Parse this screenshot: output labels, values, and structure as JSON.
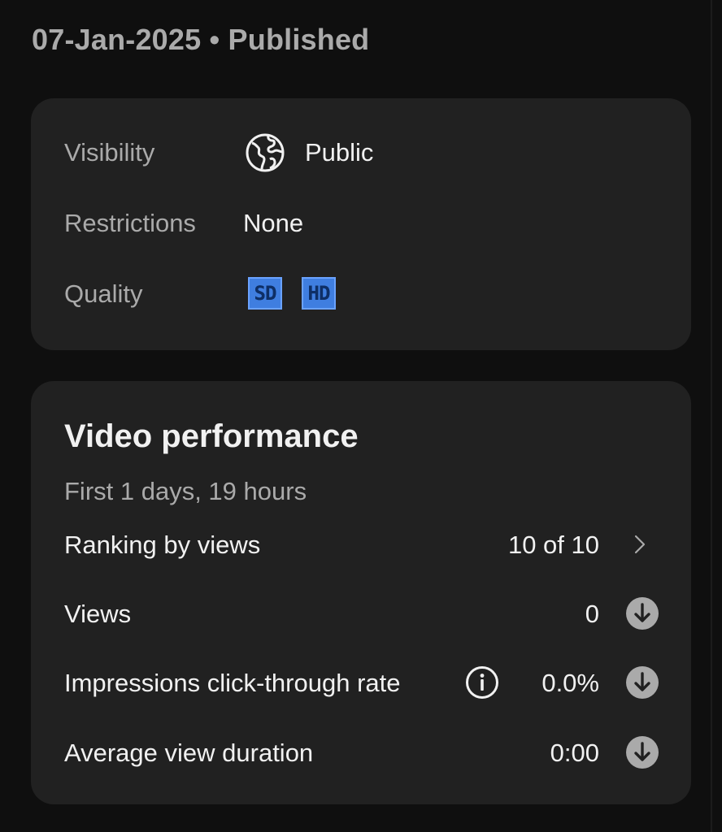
{
  "header": {
    "date_status": "07-Jan-2025 • Published"
  },
  "details": {
    "visibility": {
      "label": "Visibility",
      "value": "Public",
      "icon": "globe-icon"
    },
    "restrictions": {
      "label": "Restrictions",
      "value": "None"
    },
    "quality": {
      "label": "Quality",
      "badges": [
        "SD",
        "HD"
      ],
      "badge_color": "#3f7ee0"
    }
  },
  "performance": {
    "title": "Video performance",
    "subtitle": "First 1 days, 19 hours",
    "rows": [
      {
        "label": "Ranking by views",
        "value": "10 of 10",
        "icon": "chevron-right-icon"
      },
      {
        "label": "Views",
        "value": "0",
        "icon": "arrow-down-circle-icon"
      },
      {
        "label": "Impressions click-through rate",
        "value": "0.0%",
        "icon": "arrow-down-circle-icon",
        "info_icon": "info-icon"
      },
      {
        "label": "Average view duration",
        "value": "0:00",
        "icon": "arrow-down-circle-icon"
      }
    ]
  },
  "colors": {
    "background": "#0f0f0f",
    "card": "#212121",
    "text_primary": "#f1f1f1",
    "text_secondary": "#aaaaaa",
    "down_icon": "#aaaaaa"
  }
}
